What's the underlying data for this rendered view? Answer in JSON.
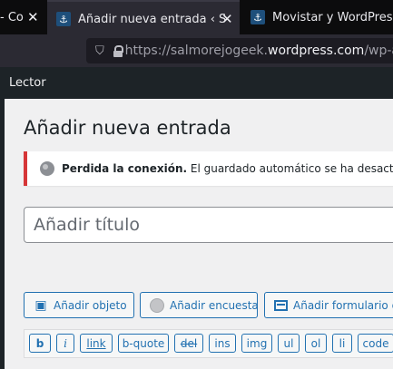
{
  "browser": {
    "tabs": [
      {
        "title": "- Co",
        "close": "✕"
      },
      {
        "title": "Añadir nueva entrada ‹ S",
        "close": "✕"
      },
      {
        "title": "Movistar y WordPress.c"
      }
    ],
    "url_prefix": "https://salmorejogeek.",
    "url_domain": "wordpress.com",
    "url_suffix": "/wp-a"
  },
  "adminbar": {
    "lector": "Lector"
  },
  "page": {
    "title": "Añadir nueva entrada",
    "notice_bold": "Perdida la conexión.",
    "notice_text": " El guardado automático se ha desactivado",
    "title_placeholder": "Añadir título"
  },
  "media_buttons": [
    {
      "label": "Añadir objeto",
      "icon": "add-object-icon"
    },
    {
      "label": "Añadir encuesta",
      "icon": "poll-icon"
    },
    {
      "label": "Añadir formulario de contacto",
      "icon": "form-icon"
    }
  ],
  "quicktags": [
    "b",
    "i",
    "link",
    "b-quote",
    "del",
    "ins",
    "img",
    "ul",
    "ol",
    "li",
    "code"
  ],
  "colors": {
    "accent": "#2271b1",
    "error": "#d63638",
    "adminbar": "#1d2327"
  }
}
